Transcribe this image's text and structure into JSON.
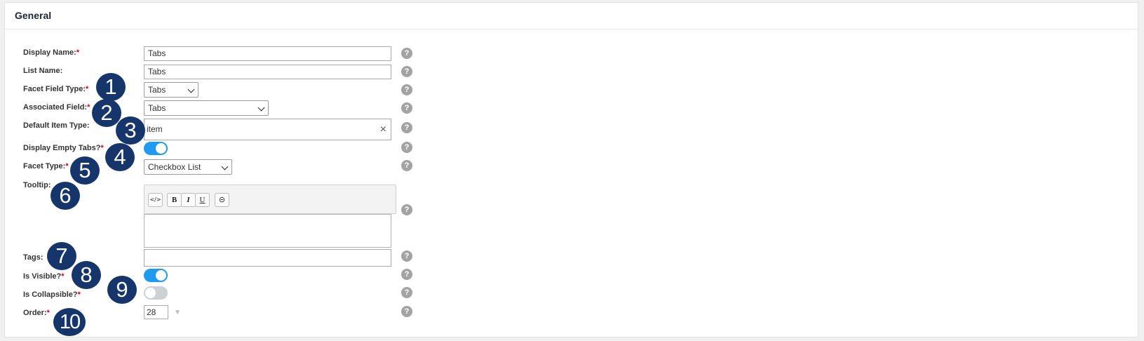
{
  "section": {
    "title": "General"
  },
  "fields": {
    "display_name": {
      "label": "Display Name:",
      "required": "*",
      "value": "Tabs"
    },
    "list_name": {
      "label": "List Name:",
      "value": "Tabs"
    },
    "facet_field_type": {
      "label": "Facet Field Type:",
      "required": "*",
      "value": "Tabs"
    },
    "associated_field": {
      "label": "Associated Field:",
      "required": "*",
      "value": "Tabs"
    },
    "default_item_type": {
      "label": "Default Item Type:",
      "value": "item",
      "clear": "×"
    },
    "display_empty_tabs": {
      "label": "Display Empty Tabs?",
      "required": "*",
      "on": true
    },
    "facet_type": {
      "label": "Facet Type:",
      "required": "*",
      "value": "Checkbox List"
    },
    "tooltip": {
      "label": "Tooltip:",
      "toolbar": {
        "code": "</>",
        "bold": "B",
        "italic": "I",
        "underline": "U",
        "link": "⊝"
      },
      "value": ""
    },
    "tags": {
      "label": "Tags:",
      "value": ""
    },
    "is_visible": {
      "label": "Is Visible?",
      "required": "*",
      "on": true
    },
    "is_collapsible": {
      "label": "Is Collapsible?",
      "required": "*",
      "on": false
    },
    "order": {
      "label": "Order:",
      "required": "*",
      "value": "28",
      "pin": "▼"
    }
  },
  "help": "?",
  "badges": [
    "1",
    "2",
    "3",
    "4",
    "5",
    "6",
    "7",
    "8",
    "9",
    "10"
  ],
  "colors": {
    "badge": "#15356b",
    "toggle_on": "#1e9bf0",
    "toggle_off": "#cdd1d6",
    "required": "#d0021b"
  }
}
